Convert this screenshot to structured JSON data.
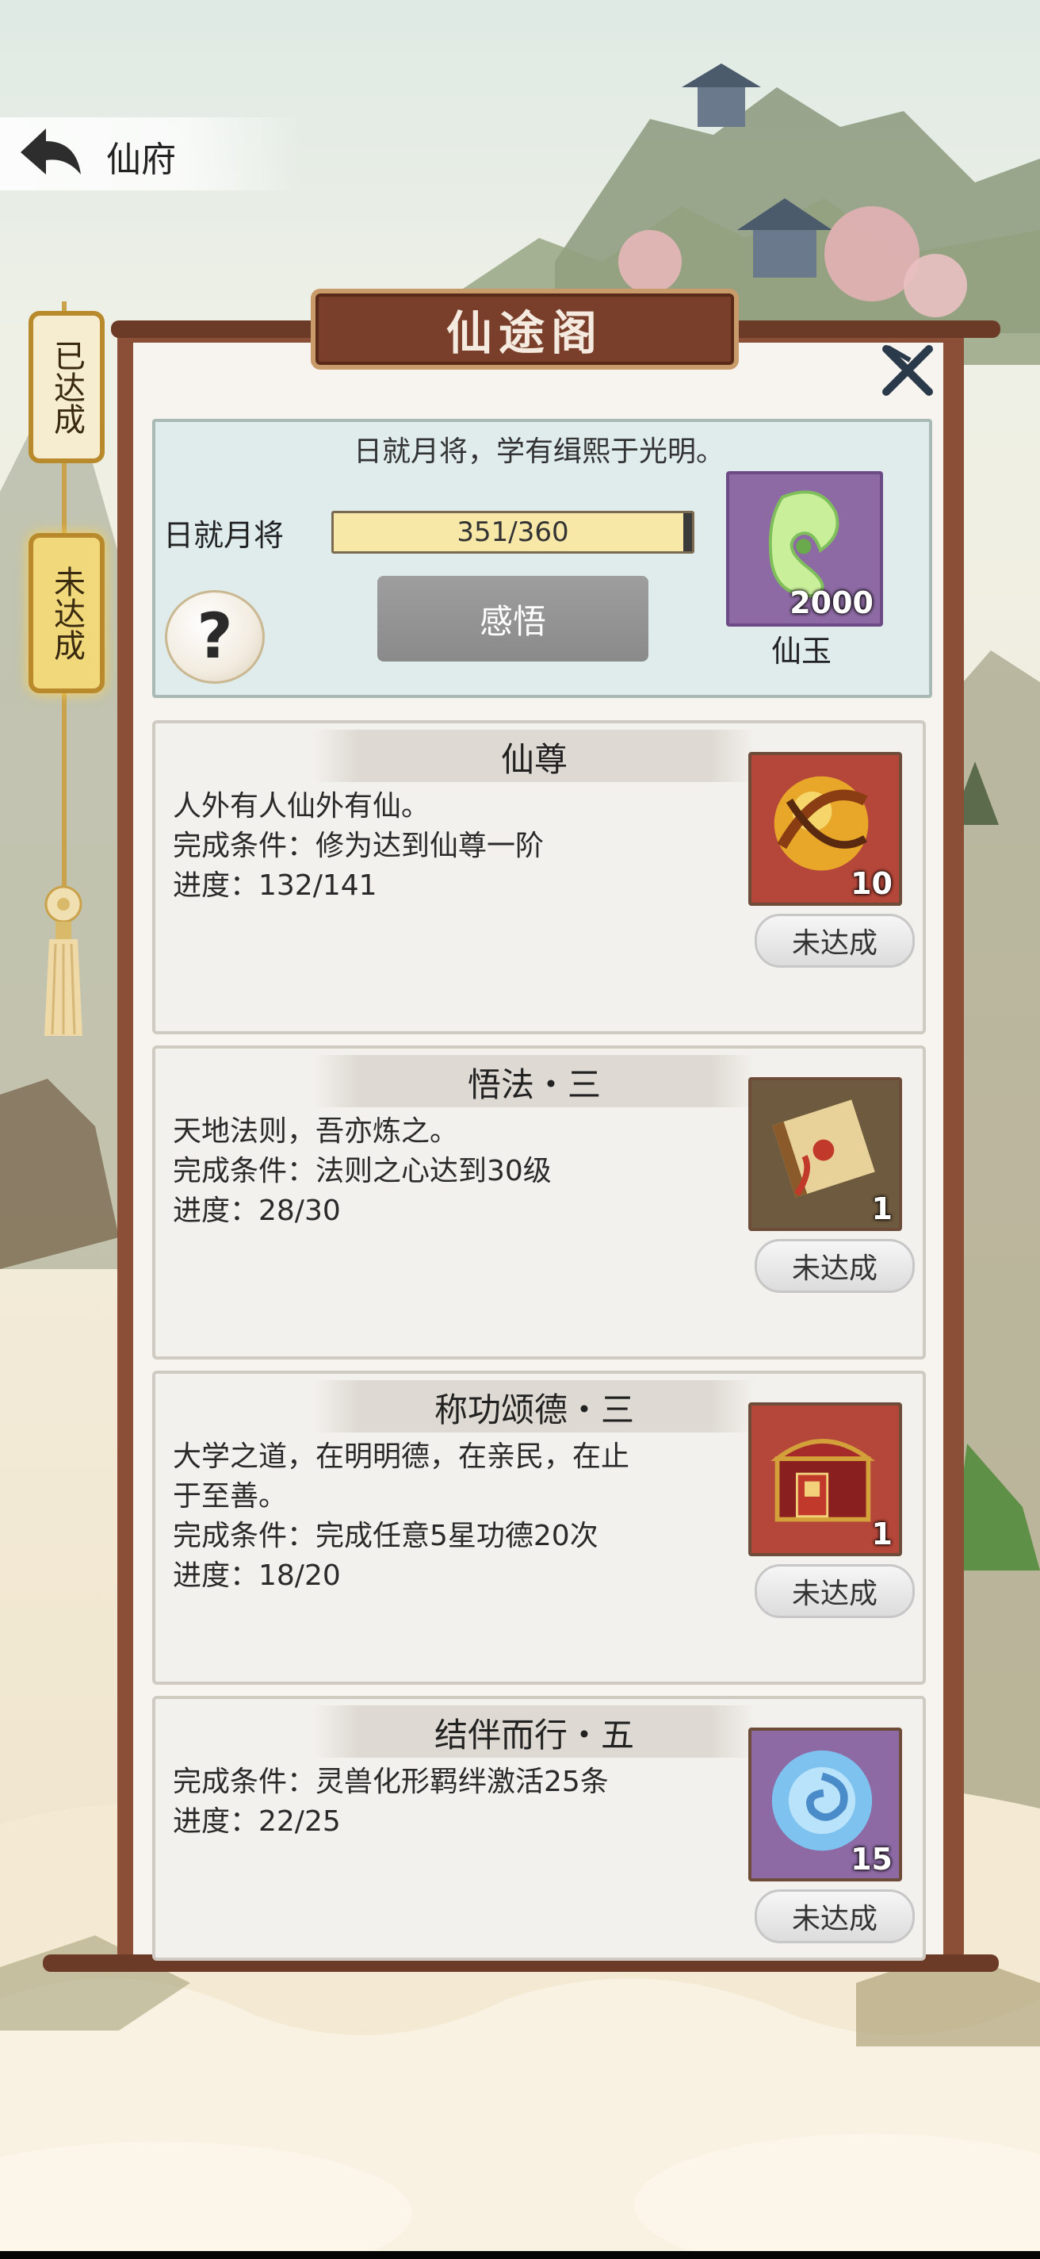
{
  "header": {
    "title": "仙府"
  },
  "side_tabs": [
    {
      "label": "已达成"
    },
    {
      "label": "未达成"
    }
  ],
  "panel": {
    "title": "仙途阁",
    "summary": {
      "motto": "日就月将，学有缉熙于光明。",
      "progress_label": "日就月将",
      "progress_text": "351/360",
      "progress_fraction": 0.975,
      "enlighten_button": "感悟",
      "help_icon": "?",
      "reward": {
        "icon": "jade-icon",
        "count": "2000",
        "name": "仙玉"
      }
    },
    "achievements": [
      {
        "title": "仙尊",
        "lines": [
          "人外有人仙外有仙。",
          "完成条件：修为达到仙尊一阶",
          "进度：132/141"
        ],
        "item": {
          "icon": "golden-orb-icon",
          "count": "10",
          "bg": "#b5473a"
        },
        "status": "未达成"
      },
      {
        "title": "悟法・三",
        "lines": [
          "天地法则，吾亦炼之。",
          "完成条件：法则之心达到30级",
          "进度：28/30"
        ],
        "item": {
          "icon": "scroll-icon",
          "count": "1",
          "bg": "#6e5a3e"
        },
        "status": "未达成"
      },
      {
        "title": "称功颂德・三",
        "lines": [
          "大学之道，在明明德，在亲民，在止",
          "于至善。",
          "完成条件：完成任意5星功德20次",
          "进度：18/20"
        ],
        "item": {
          "icon": "treasure-chest-icon",
          "count": "1",
          "bg": "#b5473a"
        },
        "status": "未达成"
      },
      {
        "title": "结伴而行・五",
        "lines": [
          "完成条件：灵兽化形羁绊激活25条",
          "进度：22/25"
        ],
        "item": {
          "icon": "spirit-orb-icon",
          "count": "15",
          "bg": "#8d6aa3"
        },
        "status": "未达成"
      }
    ]
  }
}
